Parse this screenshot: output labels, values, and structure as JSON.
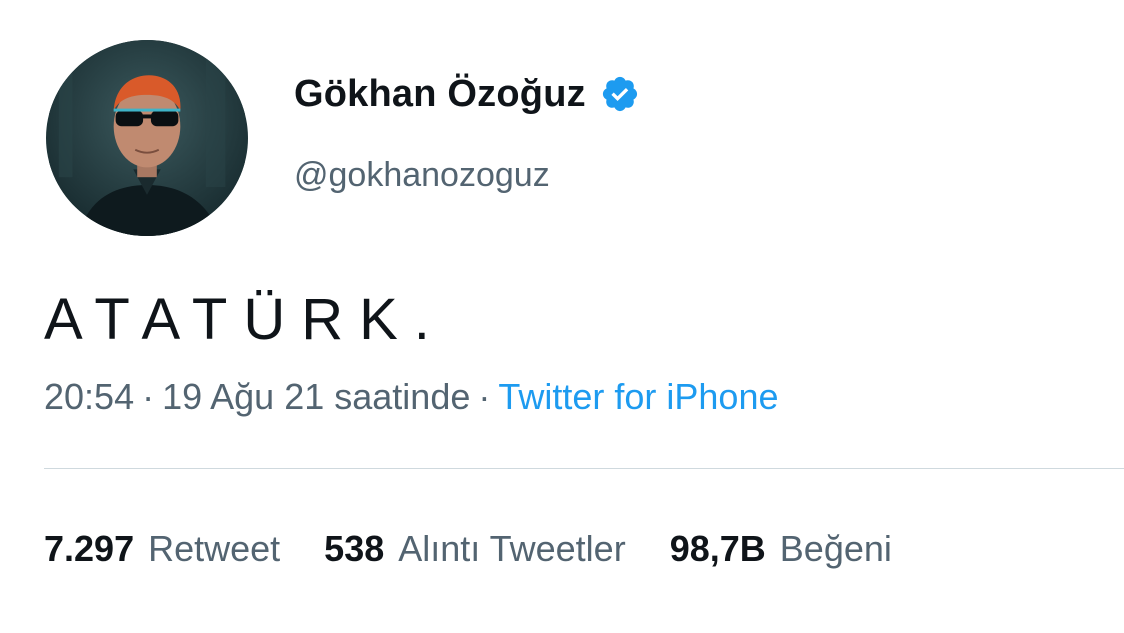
{
  "author": {
    "display_name": "Gökhan Özoğuz",
    "handle": "@gokhanozoguz",
    "verified_icon": "verified-badge-icon",
    "avatar_icon": "profile-photo"
  },
  "tweet": {
    "text": "ATATÜRK."
  },
  "meta": {
    "time": "20:54",
    "separator_1": "·",
    "date": "19 Ağu 21 saatinde",
    "separator_2": "·",
    "source": "Twitter for iPhone"
  },
  "stats": {
    "retweets": {
      "count": "7.297",
      "label": "Retweet"
    },
    "quotes": {
      "count": "538",
      "label": "Alıntı Tweetler"
    },
    "likes": {
      "count": "98,7B",
      "label": "Beğeni"
    }
  },
  "colors": {
    "text_primary": "#0f1419",
    "text_secondary": "#536471",
    "link": "#1d9bf0",
    "verified": "#1d9bf0",
    "divider": "#cfd9de"
  }
}
